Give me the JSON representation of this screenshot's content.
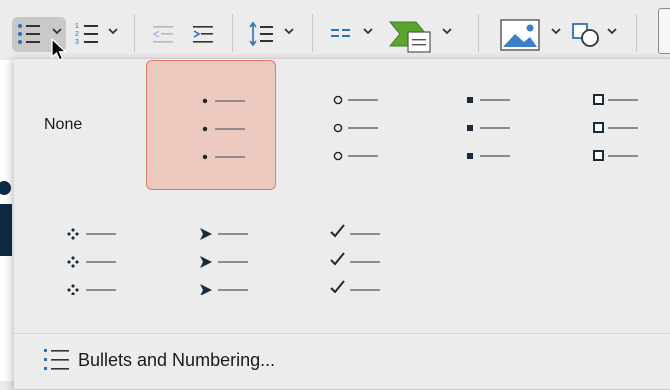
{
  "toolbar": {
    "items": [
      {
        "name": "bulleted-list-icon"
      },
      {
        "name": "numbered-list-icon"
      },
      {
        "name": "decrease-indent-icon"
      },
      {
        "name": "increase-indent-icon"
      },
      {
        "name": "line-spacing-icon"
      },
      {
        "name": "columns-icon"
      },
      {
        "name": "smartart-icon"
      },
      {
        "name": "picture-icon"
      },
      {
        "name": "shapes-icon"
      }
    ]
  },
  "bullet_menu": {
    "none_label": "None",
    "selected": "dot",
    "styles": [
      {
        "id": "none",
        "glyph": ""
      },
      {
        "id": "dot",
        "glyph": "•"
      },
      {
        "id": "hollow-circle",
        "glyph": "○"
      },
      {
        "id": "filled-square",
        "glyph": "■"
      },
      {
        "id": "hollow-square",
        "glyph": "❑"
      },
      {
        "id": "diamond",
        "glyph": "❖"
      },
      {
        "id": "arrow",
        "glyph": "➤"
      },
      {
        "id": "checkmark",
        "glyph": "✓"
      }
    ],
    "footer_label": "Bullets and Numbering..."
  },
  "colors": {
    "selected_fill": "#ecc9bf",
    "selected_border": "#e17a64",
    "icon_blue": "#2f6fbf",
    "smartart_green": "#5aa532"
  }
}
